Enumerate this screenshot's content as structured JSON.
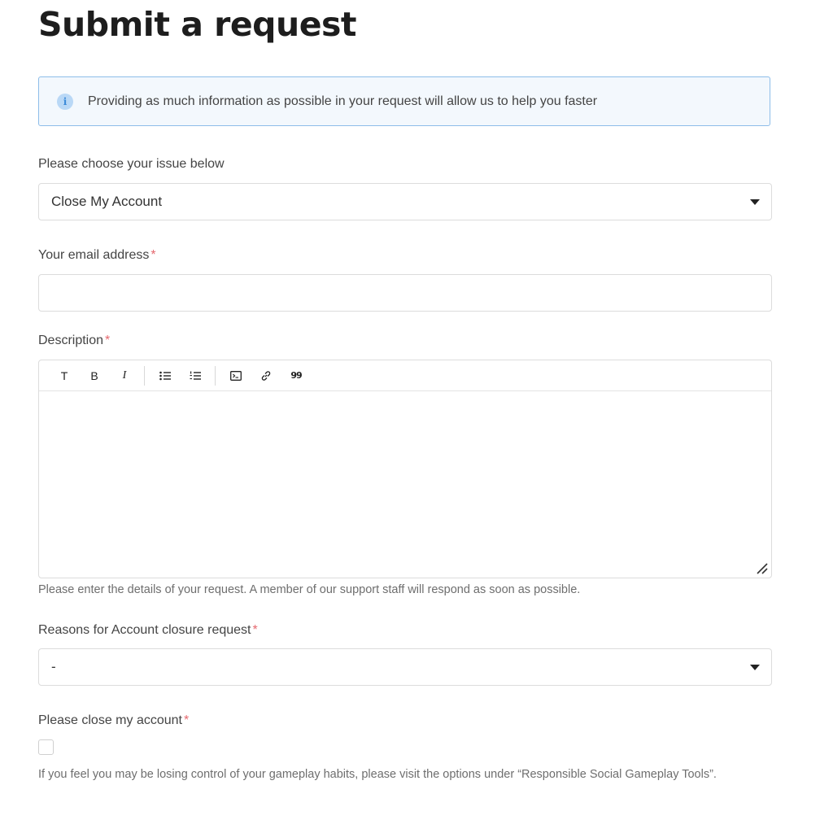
{
  "page": {
    "title": "Submit a request"
  },
  "notice": {
    "icon": "info-icon",
    "text": "Providing as much information as possible in your request will allow us to help you faster"
  },
  "issue": {
    "label": "Please choose your issue below",
    "selected": "Close My Account"
  },
  "email": {
    "label": "Your email address",
    "required_mark": "*",
    "value": ""
  },
  "description": {
    "label": "Description",
    "required_mark": "*",
    "toolbar": [
      {
        "name": "text-style-icon",
        "glyph": "T"
      },
      {
        "name": "bold-icon",
        "glyph": "B"
      },
      {
        "name": "italic-icon",
        "glyph": "I"
      },
      {
        "name": "bulleted-list-icon",
        "glyph": ""
      },
      {
        "name": "numbered-list-icon",
        "glyph": ""
      },
      {
        "name": "code-block-icon",
        "glyph": ""
      },
      {
        "name": "link-icon",
        "glyph": ""
      },
      {
        "name": "quote-icon",
        "glyph": "99"
      }
    ],
    "hint": "Please enter the details of your request. A member of our support staff will respond as soon as possible."
  },
  "reasons": {
    "label": "Reasons for Account closure request",
    "required_mark": "*",
    "selected": "-"
  },
  "confirm": {
    "label": "Please close my account",
    "required_mark": "*",
    "checked": false,
    "hint": "If you feel you may be losing control of your gameplay habits, please visit the options under “Responsible Social Gameplay Tools”."
  },
  "colors": {
    "accent_border": "#8dbde9",
    "notice_bg": "#f3f8fd",
    "required": "#e5696f"
  }
}
